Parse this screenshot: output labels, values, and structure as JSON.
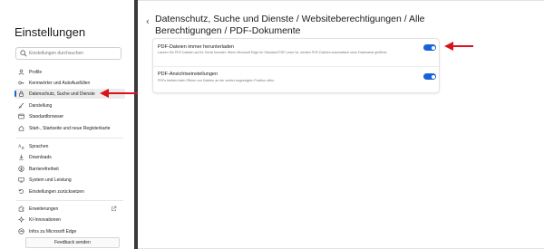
{
  "sidebar": {
    "title": "Einstellungen",
    "search_placeholder": "Einstellungen durchsuchen",
    "items": [
      {
        "label": "Profile",
        "icon": "person-icon"
      },
      {
        "label": "Kennwörter und AutoAusfüllen",
        "icon": "key-icon"
      },
      {
        "label": "Datenschutz, Suche und Dienste",
        "icon": "lock-icon",
        "active": true
      },
      {
        "label": "Darstellung",
        "icon": "brush-icon"
      },
      {
        "label": "Standardbrowser",
        "icon": "browser-icon"
      },
      {
        "label": "Start-, Startseite und neue Registerkarte",
        "icon": "home-icon"
      },
      {
        "label": "Sprachen",
        "icon": "language-icon"
      },
      {
        "label": "Downloads",
        "icon": "download-icon"
      },
      {
        "label": "Barrierefreiheit",
        "icon": "accessibility-icon"
      },
      {
        "label": "System und Leistung",
        "icon": "system-icon"
      },
      {
        "label": "Einstellungen zurücksetzen",
        "icon": "reset-icon"
      },
      {
        "label": "Erweiterungen",
        "icon": "puzzle-icon"
      },
      {
        "label": "KI-Innovationen",
        "icon": "sparkle-icon"
      },
      {
        "label": "Infos zu Microsoft Edge",
        "icon": "edge-icon"
      }
    ],
    "feedback_label": "Feedback senden"
  },
  "main": {
    "breadcrumb": "Datenschutz, Suche und Dienste / Websiteberechtigungen / Alle Berechtigungen / PDF-Dokumente",
    "settings": [
      {
        "title": "PDF-Dateien immer herunterladen",
        "description": "Lassen Sie PDF-Dateien auf Ihr Gerät herunter. Wenn Microsoft Edge Ihr Standard-PDF-Leser ist, werden PDF-Dateien automatisch ohne Dateiname geöffnet.",
        "enabled": true
      },
      {
        "title": "PDF-Ansichtseinstellungen",
        "description": "PDFs bleiben beim Öffnen von Dateien an der zuletzt angezeigten Position offen.",
        "enabled": true
      }
    ]
  },
  "colors": {
    "accent": "#1a63d6",
    "annotation": "#d9121b",
    "scrollbar": "#3a3a3a"
  }
}
